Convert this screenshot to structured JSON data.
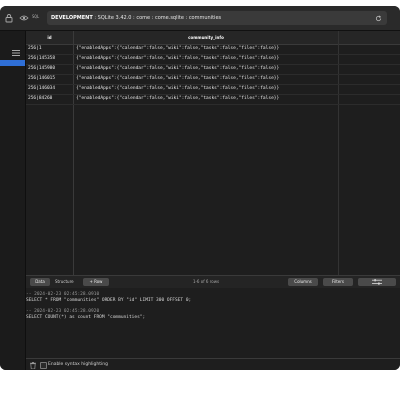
{
  "titlebar": {
    "sql_label": "SQL",
    "env": "DEVELOPMENT",
    "version_info": "SQLite 3.42.0",
    "separator": " : ",
    "db": "come",
    "file": "come.sqlite",
    "table": "communities"
  },
  "table": {
    "columns": [
      "id",
      "community_info"
    ],
    "rows": [
      {
        "id": "256|1",
        "info": "{\"enabledApps\":{\"calendar\":false,\"wiki\":false,\"tasks\":false,\"files\":false}}"
      },
      {
        "id": "256|145358",
        "info": "{\"enabledApps\":{\"calendar\":false,\"wiki\":false,\"tasks\":false,\"files\":false}}"
      },
      {
        "id": "256|145980",
        "info": "{\"enabledApps\":{\"calendar\":false,\"wiki\":false,\"tasks\":false,\"files\":false}}"
      },
      {
        "id": "256|146015",
        "info": "{\"enabledApps\":{\"calendar\":false,\"wiki\":false,\"tasks\":false,\"files\":false}}"
      },
      {
        "id": "256|146034",
        "info": "{\"enabledApps\":{\"calendar\":false,\"wiki\":false,\"tasks\":false,\"files\":false}}"
      },
      {
        "id": "256|84260",
        "info": "{\"enabledApps\":{\"calendar\":false,\"wiki\":false,\"tasks\":false,\"files\":false}}"
      }
    ]
  },
  "toolbar": {
    "data_label": "Data",
    "structure_label": "Structure",
    "new_label": "+ Row",
    "row_count": "1-6 of 6 rows",
    "columns_label": "Columns",
    "filters_label": "Filters"
  },
  "log": [
    {
      "comment": "-- 2024-02-23 02:45:28.0910",
      "sql": "SELECT * FROM  \"communities\" ORDER BY \"id\" LIMIT 300 OFFSET 0;"
    },
    {
      "comment": "-- 2024-02-23 02:45:28.0920",
      "sql": "SELECT COUNT(*) as count FROM  \"communities\";"
    }
  ],
  "footer": {
    "syntax_label": "Enable syntax highlighting"
  }
}
